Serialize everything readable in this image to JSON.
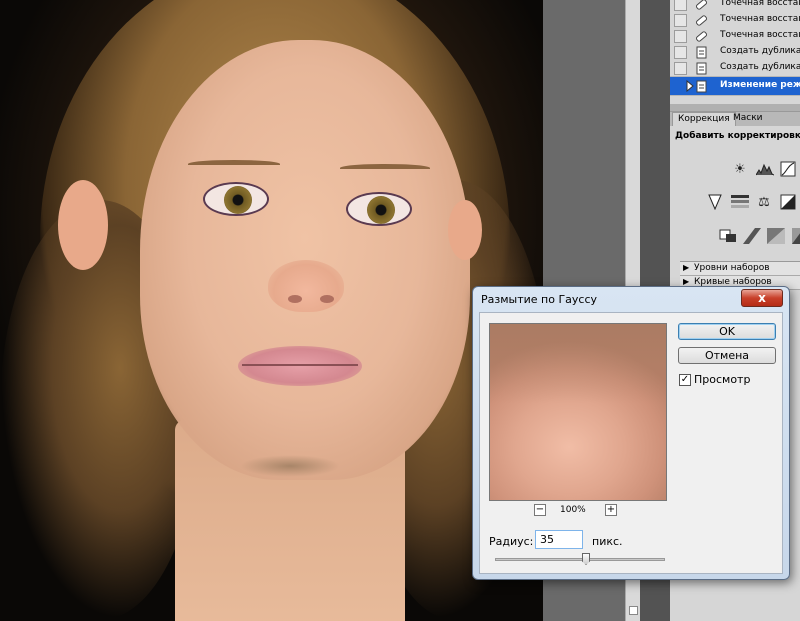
{
  "history": {
    "items": [
      {
        "label": "Точечная восстанав",
        "icon": "bandage-icon",
        "selected": false
      },
      {
        "label": "Точечная восстанав",
        "icon": "bandage-icon",
        "selected": false
      },
      {
        "label": "Точечная восстанав",
        "icon": "bandage-icon",
        "selected": false
      },
      {
        "label": "Создать дубликат с",
        "icon": "document-icon",
        "selected": false
      },
      {
        "label": "Создать дубликат с",
        "icon": "document-icon",
        "selected": false
      },
      {
        "label": "Изменение режим",
        "icon": "document-icon",
        "selected": true
      }
    ]
  },
  "panel": {
    "tabs": [
      {
        "label": "Коррекция",
        "active": true
      },
      {
        "label": "Маски",
        "active": false
      }
    ],
    "add_adjustment": "Добавить корректировку",
    "presets": [
      {
        "label": "Уровни наборов"
      },
      {
        "label": "Кривые наборов"
      }
    ]
  },
  "dialog": {
    "title": "Размытие по Гауссу",
    "close_label": "x",
    "ok_label": "OK",
    "cancel_label": "Отмена",
    "preview_label": "Просмотр",
    "preview_checked": true,
    "zoom_minus": "−",
    "zoom_plus": "+",
    "zoom_value": "100%",
    "radius_label": "Радиус:",
    "radius_value": "35",
    "radius_unit": "пикс."
  },
  "colors": {
    "selection": "#1e63d0",
    "close_button": "#c8402a"
  }
}
